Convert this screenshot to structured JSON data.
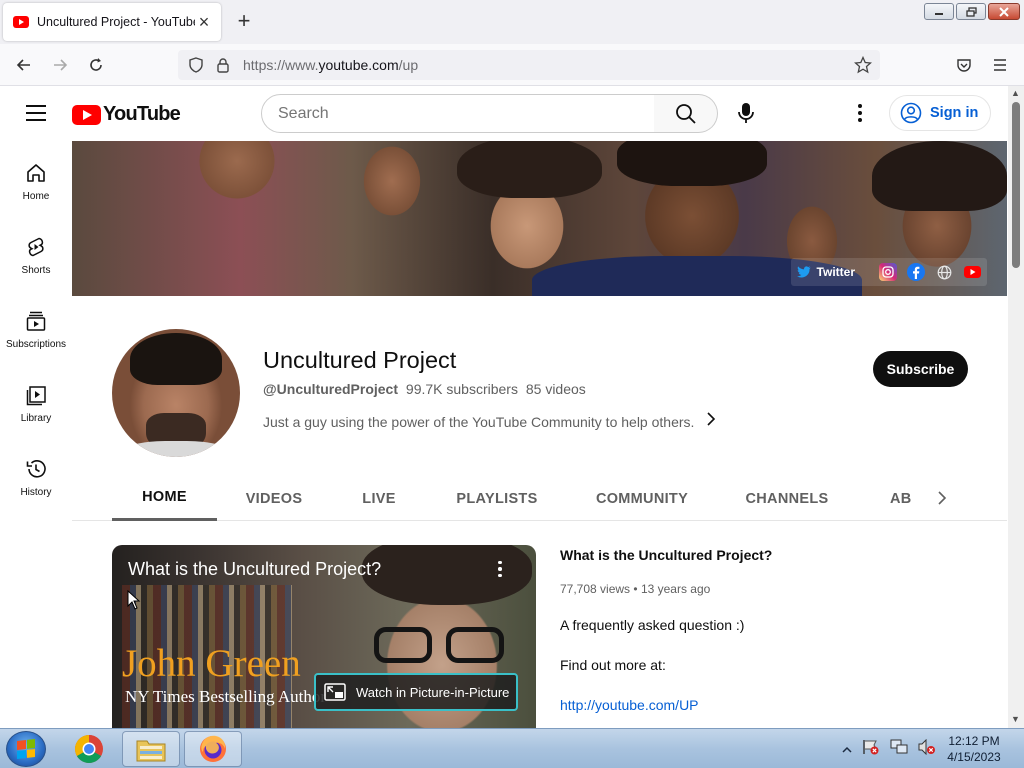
{
  "browser": {
    "tab_title": "Uncultured Project - YouTube",
    "url_scheme": "https://www.",
    "url_host": "youtube.com",
    "url_path": "/up"
  },
  "header": {
    "logo_text": "YouTube",
    "search_placeholder": "Search",
    "sign_in_label": "Sign in"
  },
  "sidebar": {
    "items": [
      {
        "label": "Home",
        "icon": "home-icon"
      },
      {
        "label": "Shorts",
        "icon": "shorts-icon"
      },
      {
        "label": "Subscriptions",
        "icon": "subscriptions-icon"
      },
      {
        "label": "Library",
        "icon": "library-icon"
      },
      {
        "label": "History",
        "icon": "history-icon"
      }
    ]
  },
  "banner": {
    "link_label": "Twitter",
    "social_icons": [
      "instagram-icon",
      "facebook-icon",
      "globe-icon",
      "youtube-icon"
    ]
  },
  "channel": {
    "name": "Uncultured Project",
    "handle": "@UnculturedProject",
    "subscribers": "99.7K subscribers",
    "videos": "85 videos",
    "description": "Just a guy using the power of the YouTube Community to help others.",
    "subscribe_label": "Subscribe"
  },
  "tabs": [
    {
      "label": "HOME",
      "active": true
    },
    {
      "label": "VIDEOS",
      "active": false
    },
    {
      "label": "LIVE",
      "active": false
    },
    {
      "label": "PLAYLISTS",
      "active": false
    },
    {
      "label": "COMMUNITY",
      "active": false
    },
    {
      "label": "CHANNELS",
      "active": false
    },
    {
      "label": "ABOUT",
      "active": false
    }
  ],
  "featured": {
    "player_title": "What is the Uncultured Project?",
    "overlay_name": "John Green",
    "overlay_subtitle": "NY Times Bestselling Author",
    "pip_label": "Watch in Picture-in-Picture",
    "title": "What is the Uncultured Project?",
    "views": "77,708 views",
    "age": "13 years ago",
    "desc_line1": "A frequently asked question :)",
    "desc_line2": "Find out more at:",
    "desc_link": "http://youtube.com/UP"
  },
  "taskbar": {
    "apps": [
      "chrome-icon",
      "file-explorer-icon",
      "firefox-icon"
    ],
    "time": "12:12 PM",
    "date": "4/15/2023"
  },
  "colors": {
    "youtube_red": "#ff0000",
    "link_blue": "#065fd4",
    "subscribe_bg": "#0f0f0f",
    "pip_border": "#3ac0c8"
  }
}
